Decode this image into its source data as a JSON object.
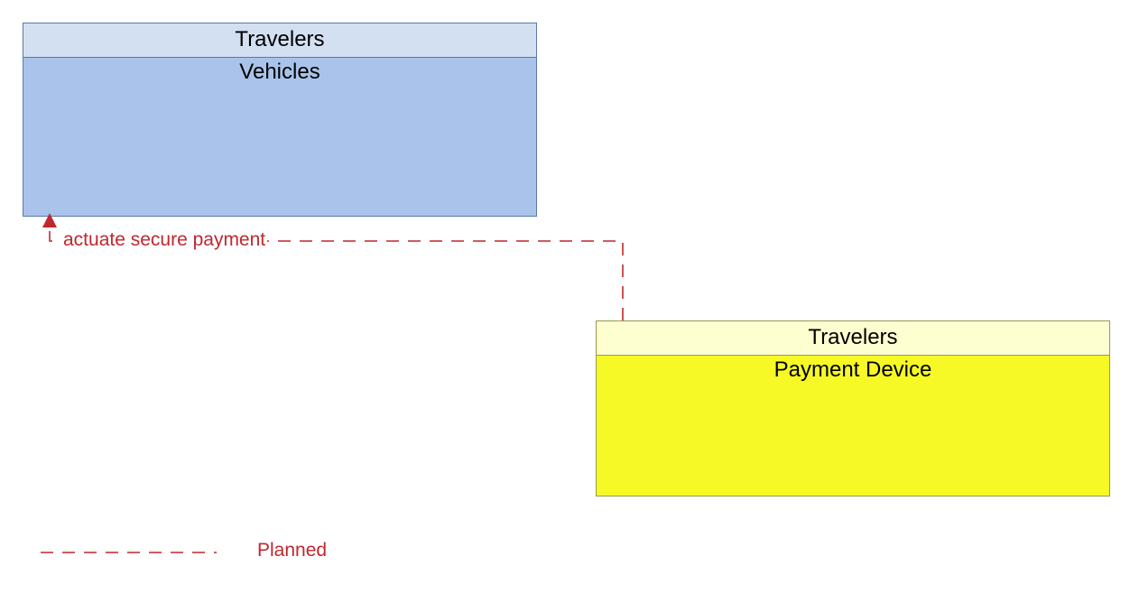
{
  "boxes": {
    "vehicles": {
      "header": "Travelers",
      "body_label": "Vehicles"
    },
    "payment": {
      "header": "Travelers",
      "body_label": "Payment Device"
    }
  },
  "flows": {
    "payment_to_vehicles": {
      "label": "actuate secure payment",
      "status": "planned"
    }
  },
  "legend": {
    "planned_label": "Planned"
  },
  "colors": {
    "planned_line": "#c1272d",
    "vehicles_header_bg": "#d3e0f2",
    "vehicles_body_bg": "#a9c3ea",
    "vehicles_border": "#5b7aa8",
    "payment_header_bg": "#feffd0",
    "payment_body_bg": "#f7f926",
    "payment_border": "#98994e"
  }
}
